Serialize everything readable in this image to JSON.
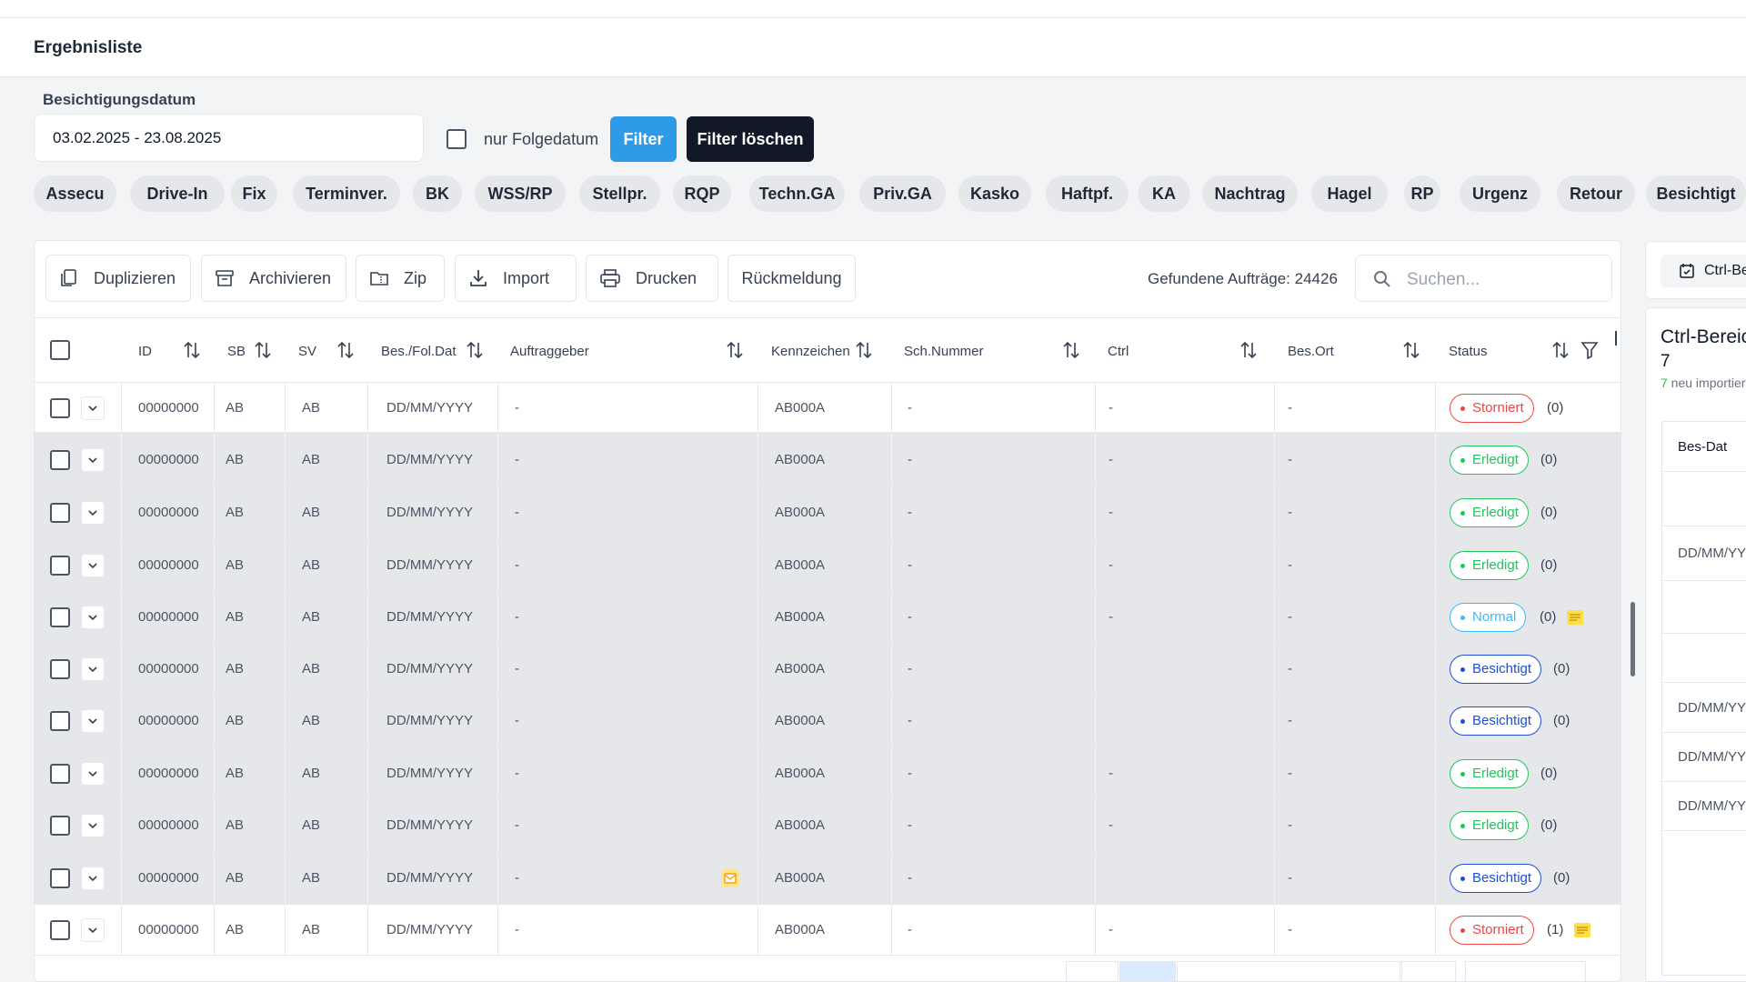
{
  "page": {
    "title": "Ergebnisliste"
  },
  "filter": {
    "date_label": "Besichtigungsdatum",
    "date_value": "03.02.2025 - 23.08.2025",
    "followup_label": "nur Folgedatum",
    "filter_button": "Filter",
    "clear_button": "Filter löschen"
  },
  "chips": [
    "Assecu",
    "Drive-In",
    "Fix",
    "Terminver.",
    "BK",
    "WSS/RP",
    "Stellpr.",
    "RQP",
    "Techn.GA",
    "Priv.GA",
    "Kasko",
    "Haftpf.",
    "KA",
    "Nachtrag",
    "Hagel",
    "RP",
    "Urgenz",
    "Retour",
    "Besichtigt"
  ],
  "toolbar": {
    "duplicate": "Duplizieren",
    "archive": "Archivieren",
    "zip": "Zip",
    "import": "Import",
    "print": "Drucken",
    "feedback": "Rückmeldung",
    "found_orders": "Gefundene Aufträge: 24426",
    "search_placeholder": "Suchen..."
  },
  "columns": {
    "id": "ID",
    "sb": "SB",
    "sv": "SV",
    "date": "Bes./Fol.Dat",
    "client": "Auftraggeber",
    "plate": "Kennzeichen",
    "claim_number": "Sch.Nummer",
    "ctrl": "Ctrl",
    "location": "Bes.Ort",
    "status": "Status"
  },
  "rows": [
    {
      "id": "00000000",
      "sb": "AB",
      "sv": "AB",
      "date": "DD/MM/YYYY",
      "client": "-",
      "plate": "AB000A",
      "claim": "-",
      "ctrl": "-",
      "location": "-",
      "status": "Storniert",
      "count": "(0)",
      "note": false,
      "mail": false
    },
    {
      "id": "00000000",
      "sb": "AB",
      "sv": "AB",
      "date": "DD/MM/YYYY",
      "client": "-",
      "plate": "AB000A",
      "claim": "-",
      "ctrl": "-",
      "location": "-",
      "status": "Erledigt",
      "count": "(0)",
      "note": false,
      "mail": false
    },
    {
      "id": "00000000",
      "sb": "AB",
      "sv": "AB",
      "date": "DD/MM/YYYY",
      "client": "-",
      "plate": "AB000A",
      "claim": "-",
      "ctrl": "-",
      "location": "-",
      "status": "Erledigt",
      "count": "(0)",
      "note": false,
      "mail": false
    },
    {
      "id": "00000000",
      "sb": "AB",
      "sv": "AB",
      "date": "DD/MM/YYYY",
      "client": "-",
      "plate": "AB000A",
      "claim": "-",
      "ctrl": "-",
      "location": "-",
      "status": "Erledigt",
      "count": "(0)",
      "note": false,
      "mail": false
    },
    {
      "id": "00000000",
      "sb": "AB",
      "sv": "AB",
      "date": "DD/MM/YYYY",
      "client": "-",
      "plate": "AB000A",
      "claim": "-",
      "ctrl": "-",
      "location": "-",
      "status": "Normal",
      "count": "(0)",
      "note": true,
      "mail": false
    },
    {
      "id": "00000000",
      "sb": "AB",
      "sv": "AB",
      "date": "DD/MM/YYYY",
      "client": "-",
      "plate": "AB000A",
      "claim": "-",
      "ctrl": "",
      "location": "-",
      "status": "Besichtigt",
      "count": "(0)",
      "note": false,
      "mail": false
    },
    {
      "id": "00000000",
      "sb": "AB",
      "sv": "AB",
      "date": "DD/MM/YYYY",
      "client": "-",
      "plate": "AB000A",
      "claim": "-",
      "ctrl": "",
      "location": "-",
      "status": "Besichtigt",
      "count": "(0)",
      "note": false,
      "mail": false
    },
    {
      "id": "00000000",
      "sb": "AB",
      "sv": "AB",
      "date": "DD/MM/YYYY",
      "client": "-",
      "plate": "AB000A",
      "claim": "-",
      "ctrl": "-",
      "location": "-",
      "status": "Erledigt",
      "count": "(0)",
      "note": false,
      "mail": false
    },
    {
      "id": "00000000",
      "sb": "AB",
      "sv": "AB",
      "date": "DD/MM/YYYY",
      "client": "-",
      "plate": "AB000A",
      "claim": "-",
      "ctrl": "-",
      "location": "-",
      "status": "Erledigt",
      "count": "(0)",
      "note": false,
      "mail": false
    },
    {
      "id": "00000000",
      "sb": "AB",
      "sv": "AB",
      "date": "DD/MM/YYYY",
      "client": "-",
      "plate": "AB000A",
      "claim": "-",
      "ctrl": "",
      "location": "-",
      "status": "Besichtigt",
      "count": "(0)",
      "note": false,
      "mail": true
    },
    {
      "id": "00000000",
      "sb": "AB",
      "sv": "AB",
      "date": "DD/MM/YYYY",
      "client": "-",
      "plate": "AB000A",
      "claim": "-",
      "ctrl": "-",
      "location": "-",
      "status": "Storniert",
      "count": "(1)",
      "note": true,
      "mail": false
    }
  ],
  "status_colors": {
    "Storniert": "#ef4444",
    "Erledigt": "#22c55e",
    "Normal": "#38bdf8",
    "Besichtigt": "#1d4ed8"
  },
  "side_panel": {
    "tab_label": "Ctrl-Bereich",
    "title": "Ctrl-Bereich",
    "count": "7",
    "subtitle_count": "7",
    "subtitle_text": " neu importiert",
    "column_header": "Bes-Dat",
    "rows": [
      "",
      "DD/MM/YYYY",
      "",
      "",
      "DD/MM/YYYY",
      "DD/MM/YYYY",
      "DD/MM/YYYY"
    ]
  }
}
